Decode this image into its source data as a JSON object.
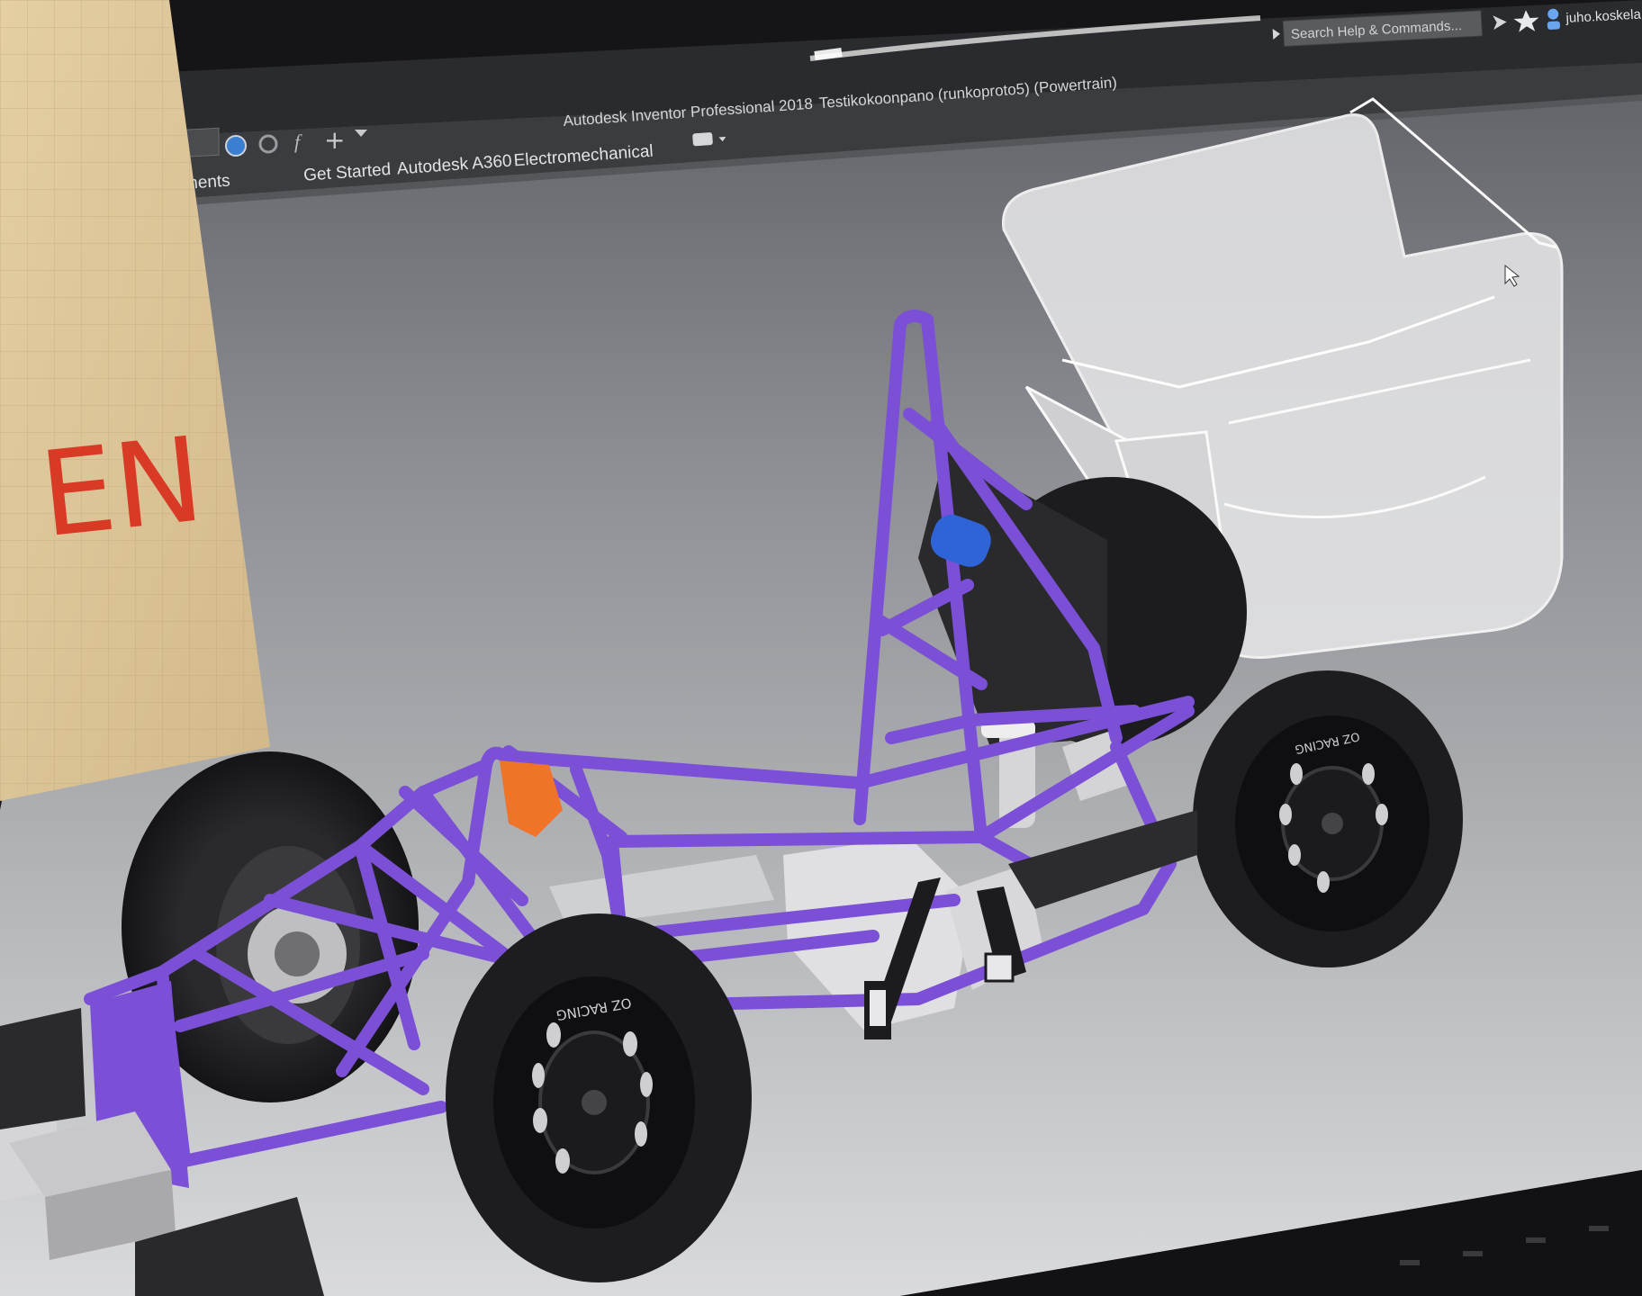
{
  "app": {
    "window_title": "Autodesk Inventor Professional 2018",
    "document_title": "Testikokoonpano (runkoproto5) (Powertrain)"
  },
  "search": {
    "placeholder": "Search Help & Commands..."
  },
  "user": {
    "name": "juho.koskela"
  },
  "ribbon": {
    "tabs": [
      {
        "label": "Environments"
      },
      {
        "label": "Get Started"
      },
      {
        "label": "Autodesk A360"
      },
      {
        "label": "Electromechanical"
      }
    ]
  },
  "model": {
    "tire_brand": "OZ RACING",
    "frame_color": "#7b4fd6",
    "bodywork_color": "#dcdcdc"
  },
  "background_note": {
    "text": "EN"
  },
  "colors": {
    "viewport_top": "#6a6c70",
    "viewport_bottom": "#d8d9db",
    "titlebar": "#2c2d30",
    "frame": "#7b4fd6",
    "accent_orange": "#f07428"
  },
  "icons": {
    "search": "search-icon",
    "star": "star-icon",
    "user": "user-icon",
    "arrow": "cursor-arrow-icon"
  }
}
